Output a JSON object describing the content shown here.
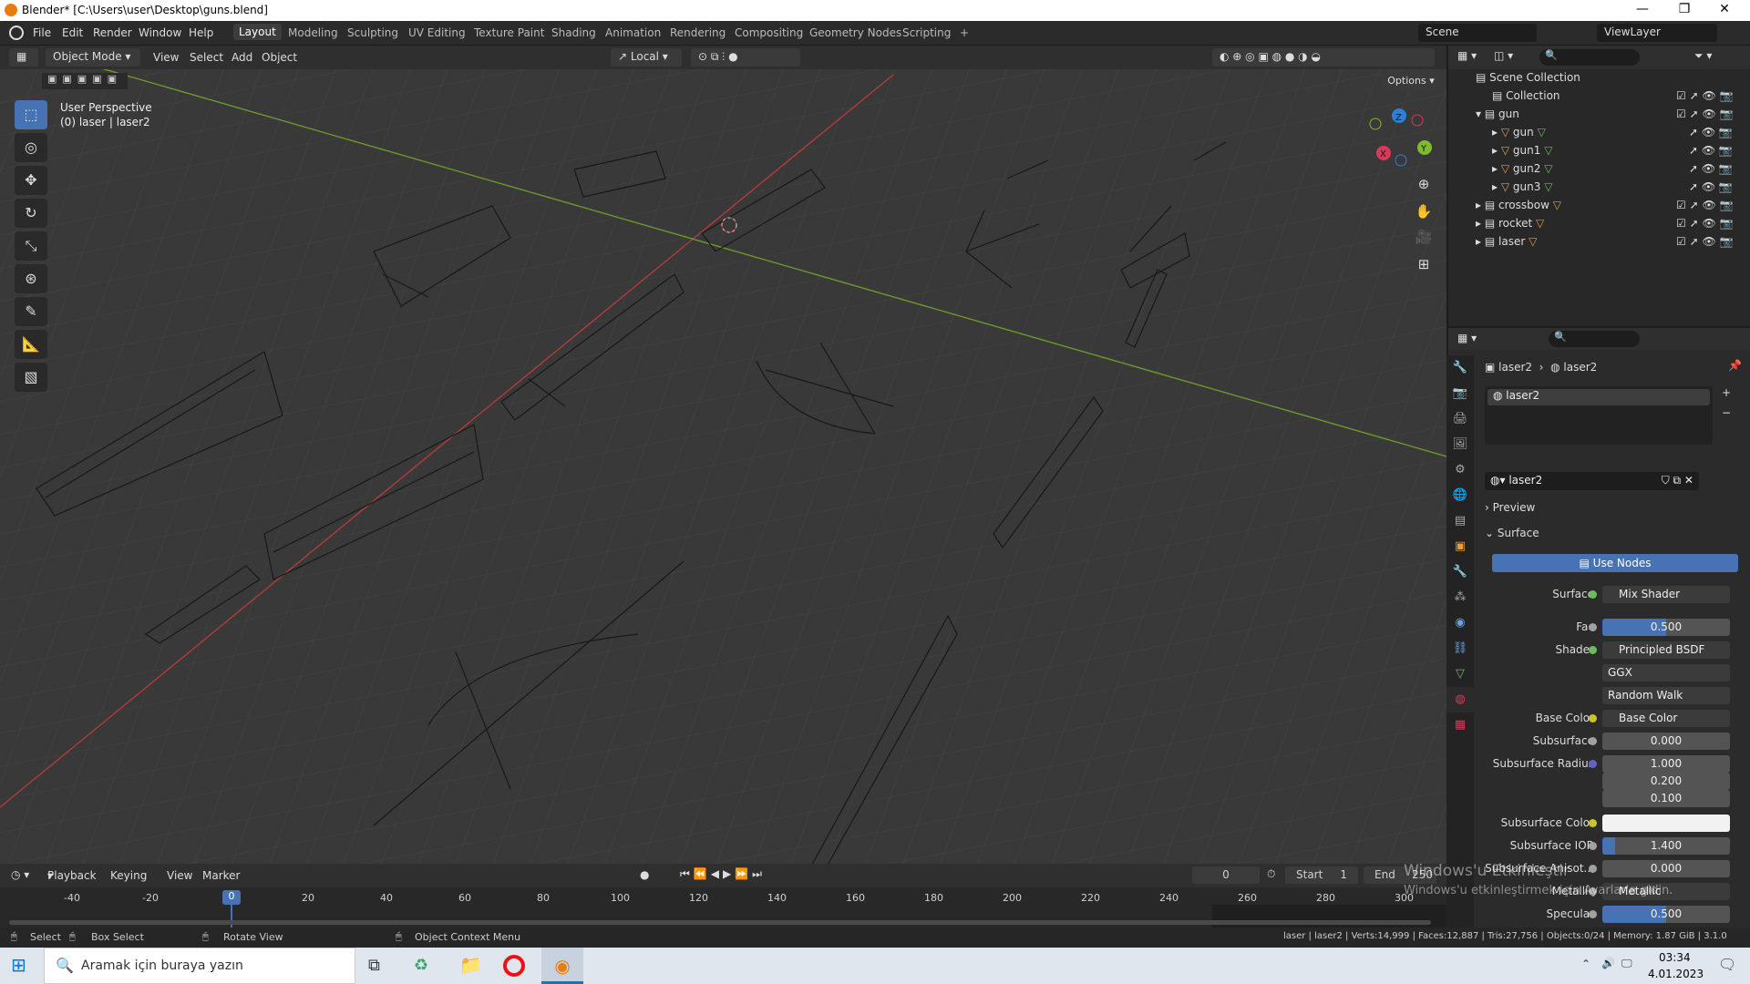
{
  "title_bar": {
    "title": "Blender* [C:\\Users\\user\\Desktop\\guns.blend]",
    "minimize": "—",
    "maximize": "❐",
    "close": "✕"
  },
  "menu": [
    "File",
    "Edit",
    "Render",
    "Window",
    "Help"
  ],
  "workspaces": [
    "Layout",
    "Modeling",
    "Sculpting",
    "UV Editing",
    "Texture Paint",
    "Shading",
    "Animation",
    "Rendering",
    "Compositing",
    "Geometry Nodes",
    "Scripting",
    "+"
  ],
  "active_workspace": "Layout",
  "scene": "Scene",
  "view_layer": "ViewLayer",
  "viewport_header": {
    "mode": "Object Mode",
    "menus": [
      "View",
      "Select",
      "Add",
      "Object"
    ],
    "transform_orientation": "Local",
    "options": "Options"
  },
  "viewport": {
    "perspective": "User Perspective",
    "object_info": "(0) laser | laser2"
  },
  "gizmo": {
    "z": "Z",
    "y": "Y",
    "x": "X"
  },
  "outliner": {
    "root": "Scene Collection",
    "rows": [
      {
        "label": "Collection",
        "indent": 0
      },
      {
        "label": "gun",
        "indent": 0
      },
      {
        "label": "gun",
        "indent": 1
      },
      {
        "label": "gun1",
        "indent": 1
      },
      {
        "label": "gun2",
        "indent": 1
      },
      {
        "label": "gun3",
        "indent": 1
      },
      {
        "label": "crossbow",
        "indent": 0
      },
      {
        "label": "rocket",
        "indent": 0
      },
      {
        "label": "laser",
        "indent": 0
      }
    ]
  },
  "properties": {
    "breadcrumb_object": "laser2",
    "breadcrumb_material": "laser2",
    "slot": "laser2",
    "material_name": "laser2",
    "panels": {
      "preview": "Preview",
      "surface": "Surface"
    },
    "use_nodes": "Use Nodes",
    "rows": [
      {
        "label": "Surface",
        "value": "Mix Shader",
        "kind": "socket"
      },
      {
        "label": "Fac",
        "value": "0.500",
        "kind": "slider"
      },
      {
        "label": "Shader",
        "value": "Principled BSDF",
        "kind": "socket"
      },
      {
        "label": "",
        "value": "GGX",
        "kind": "dropdown"
      },
      {
        "label": "",
        "value": "Random Walk",
        "kind": "dropdown"
      },
      {
        "label": "Base Color",
        "value": "Base Color",
        "kind": "socket"
      },
      {
        "label": "Subsurface",
        "value": "0.000",
        "kind": "number"
      },
      {
        "label": "Subsurface Radius",
        "value": "1.000",
        "kind": "number"
      },
      {
        "label": "",
        "value": "0.200",
        "kind": "number"
      },
      {
        "label": "",
        "value": "0.100",
        "kind": "number"
      },
      {
        "label": "Subsurface Color",
        "value": "",
        "kind": "color"
      },
      {
        "label": "Subsurface IOR",
        "value": "1.400",
        "kind": "number"
      },
      {
        "label": "Subsurface Anisot...",
        "value": "0.000",
        "kind": "number"
      },
      {
        "label": "Metallic",
        "value": "Metallic",
        "kind": "socket"
      },
      {
        "label": "Specular",
        "value": "0.500",
        "kind": "slider"
      }
    ]
  },
  "timeline": {
    "menus": [
      "Playback",
      "Keying",
      "View",
      "Marker"
    ],
    "current_frame": "0",
    "start_label": "Start",
    "start": "1",
    "end_label": "End",
    "end": "250",
    "ticks": [
      "-40",
      "-20",
      "0",
      "20",
      "40",
      "60",
      "80",
      "100",
      "120",
      "140",
      "160",
      "180",
      "200",
      "220",
      "240",
      "260",
      "280",
      "300"
    ]
  },
  "statusbar": {
    "select": "Select",
    "box_select": "Box Select",
    "rotate_view": "Rotate View",
    "context_menu": "Object Context Menu",
    "stats": "laser | laser2 | Verts:14,999 | Faces:12,887 | Tris:27,756 | Objects:0/24 | Memory: 1.87 GiB | 3.1.0"
  },
  "watermark": {
    "line1": "Windows'u Etkinleştir",
    "line2": "Windows'u etkinleştirmek için Ayarlar'a gidin."
  },
  "taskbar": {
    "search_placeholder": "Aramak için buraya yazın",
    "time": "03:34",
    "date": "4.01.2023"
  }
}
